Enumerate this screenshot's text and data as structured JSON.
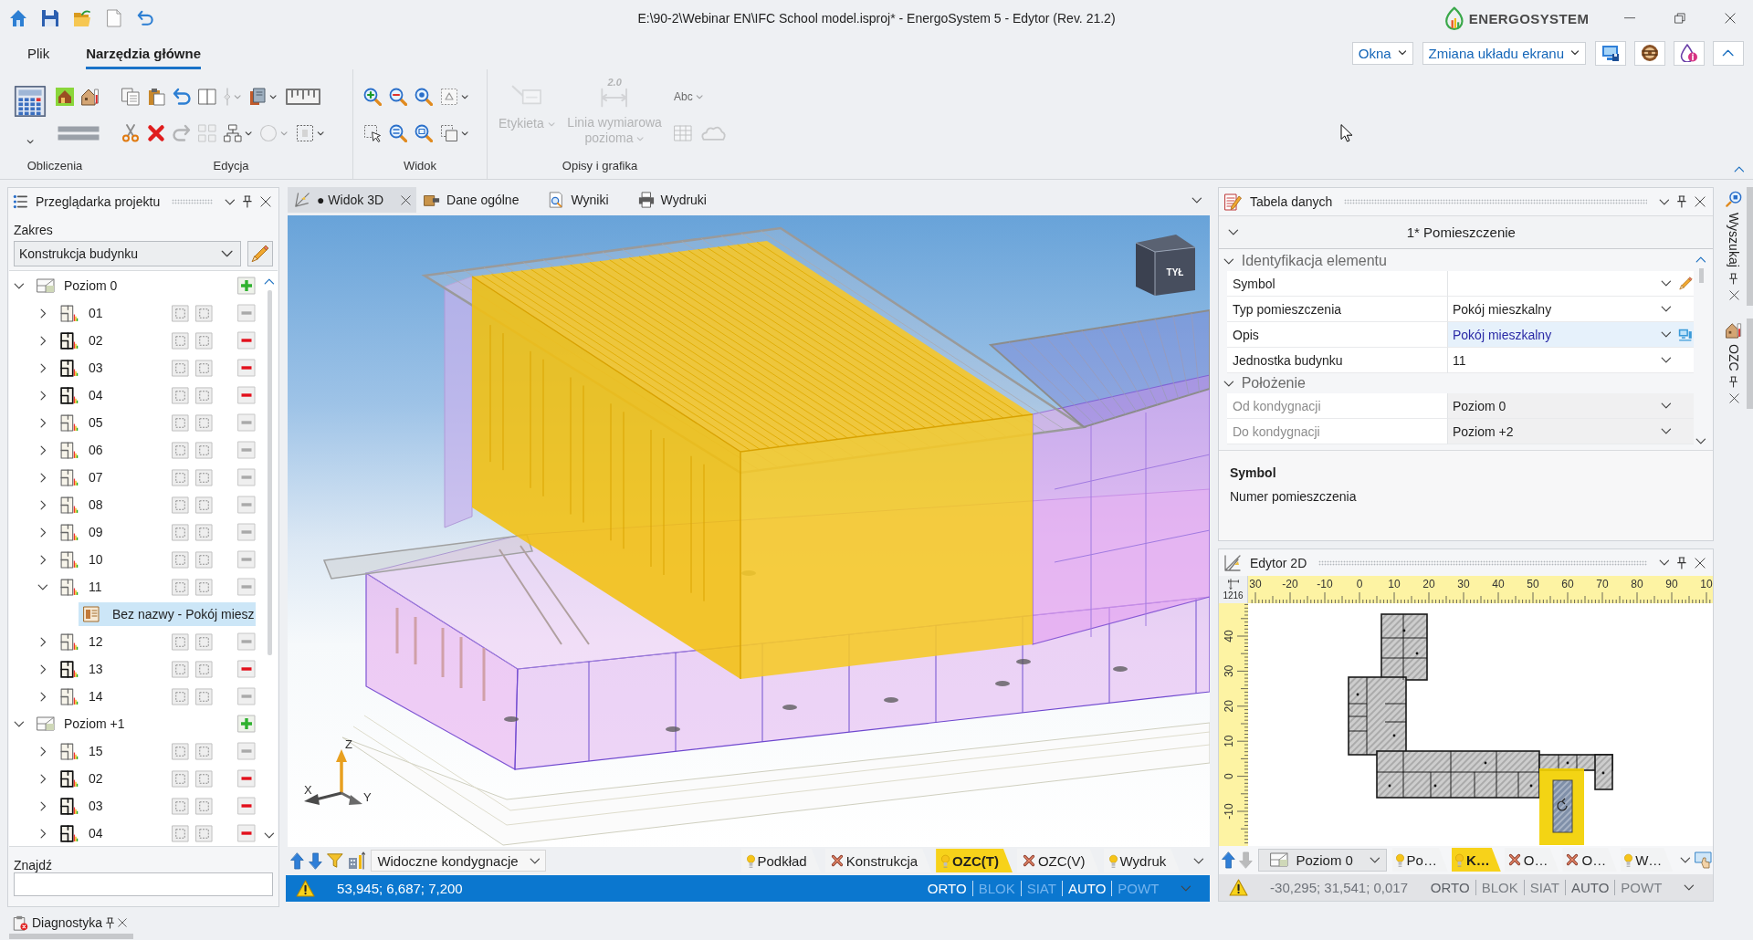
{
  "window": {
    "title": "E:\\90-2\\Webinar EN\\IFC School model.isproj* - EnergoSystem 5 - Edytor (Rev. 21.2)",
    "logo": "ENERGOSYSTEM"
  },
  "ribbon": {
    "tabs": [
      {
        "label": "Plik",
        "selected": false
      },
      {
        "label": "Narzędzia główne",
        "selected": true
      }
    ],
    "menus": [
      "Okna",
      "Zmiana układu ekranu"
    ],
    "groups": [
      {
        "label": "Obliczenia",
        "large": [
          {
            "kind": "calculator",
            "disabled": false,
            "dropdown": true
          }
        ],
        "rows": [
          [
            {
              "kind": "house",
              "disabled": false,
              "dropdown": false
            },
            {
              "kind": "house-thermometer",
              "disabled": false,
              "dropdown": false
            }
          ],
          [
            {
              "kind": "double-line",
              "disabled": false,
              "dropdown": false
            }
          ]
        ]
      },
      {
        "label": "Edycja",
        "rows": [
          [
            {
              "kind": "copy",
              "disabled": false,
              "dropdown": false
            },
            {
              "kind": "clipboard",
              "disabled": false,
              "dropdown": false
            },
            {
              "kind": "undo-arrow",
              "disabled": false,
              "dropdown": false
            },
            {
              "kind": "split-panel",
              "disabled": false,
              "dropdown": false
            },
            {
              "kind": "vertical-line",
              "disabled": true,
              "dropdown": true
            },
            {
              "kind": "book-stack",
              "disabled": false,
              "dropdown": true
            },
            {
              "kind": "ruler-strip",
              "disabled": false,
              "dropdown": false
            }
          ],
          [
            {
              "kind": "scissors",
              "disabled": false,
              "dropdown": false
            },
            {
              "kind": "cross",
              "disabled": false,
              "dropdown": false
            },
            {
              "kind": "redo-arrow",
              "disabled": true,
              "dropdown": false
            },
            {
              "kind": "tile-grid",
              "disabled": true,
              "dropdown": false
            },
            {
              "kind": "network",
              "disabled": false,
              "dropdown": true
            },
            {
              "kind": "circle",
              "disabled": true,
              "dropdown": true
            },
            {
              "kind": "dashed-frame",
              "disabled": false,
              "dropdown": true
            }
          ]
        ]
      },
      {
        "label": "Widok",
        "rows": [
          [
            {
              "kind": "magnifier-plus",
              "disabled": false,
              "dropdown": false
            },
            {
              "kind": "magnifier-minus",
              "disabled": false,
              "dropdown": false
            },
            {
              "kind": "magnifier",
              "disabled": false,
              "dropdown": false
            },
            {
              "kind": "dashed-square",
              "disabled": false,
              "dropdown": true
            }
          ],
          [
            {
              "kind": "dashed-pointer",
              "disabled": false,
              "dropdown": false
            },
            {
              "kind": "magnifier-fit",
              "disabled": false,
              "dropdown": false
            },
            {
              "kind": "magnifier-window",
              "disabled": false,
              "dropdown": false
            },
            {
              "kind": "dashed-copy",
              "disabled": false,
              "dropdown": true
            }
          ]
        ]
      },
      {
        "label": "Opisy i grafika",
        "large": [
          {
            "kind": "tag",
            "label": "Etykieta",
            "disabled": true,
            "dropdown": true
          },
          {
            "kind": "dimension-line",
            "icon_text": "2.0",
            "label": "Linia wymiarowa pozioma",
            "disabled": true,
            "dropdown": true
          }
        ],
        "rows": [
          [
            {
              "kind": "text-style",
              "text": "Abc",
              "disabled": true,
              "dropdown": true
            }
          ],
          [
            {
              "kind": "table-grid",
              "disabled": true,
              "dropdown": false
            },
            {
              "kind": "cloud",
              "disabled": true,
              "dropdown": false
            }
          ]
        ]
      }
    ]
  },
  "project_browser": {
    "title": "Przeglądarka projektu",
    "scope_label": "Zakres",
    "scope_value": "Konstrukcja budynku",
    "search_label": "Znajdź",
    "tree": [
      {
        "label": "Poziom 0",
        "kind": "level",
        "expanded": true,
        "selected": false,
        "children": [
          {
            "label": "01",
            "kind": "unit",
            "expanded": false,
            "selected": false,
            "remove_enabled": false
          },
          {
            "label": "02",
            "kind": "unit",
            "expanded": false,
            "selected": false,
            "remove_enabled": true
          },
          {
            "label": "03",
            "kind": "unit",
            "expanded": false,
            "selected": false,
            "remove_enabled": true
          },
          {
            "label": "04",
            "kind": "unit",
            "expanded": false,
            "selected": false,
            "remove_enabled": true
          },
          {
            "label": "05",
            "kind": "unit",
            "expanded": false,
            "selected": false,
            "remove_enabled": false
          },
          {
            "label": "06",
            "kind": "unit",
            "expanded": false,
            "selected": false,
            "remove_enabled": false
          },
          {
            "label": "07",
            "kind": "unit",
            "expanded": false,
            "selected": false,
            "remove_enabled": false
          },
          {
            "label": "08",
            "kind": "unit",
            "expanded": false,
            "selected": false,
            "remove_enabled": false
          },
          {
            "label": "09",
            "kind": "unit",
            "expanded": false,
            "selected": false,
            "remove_enabled": false
          },
          {
            "label": "10",
            "kind": "unit",
            "expanded": false,
            "selected": false,
            "remove_enabled": false
          },
          {
            "label": "11",
            "kind": "unit",
            "expanded": true,
            "selected": false,
            "remove_enabled": false,
            "children": [
              {
                "label": "Bez nazwy - Pokój miesz",
                "kind": "room",
                "selected": true
              }
            ]
          },
          {
            "label": "12",
            "kind": "unit",
            "expanded": false,
            "selected": false,
            "remove_enabled": false
          },
          {
            "label": "13",
            "kind": "unit",
            "expanded": false,
            "selected": false,
            "remove_enabled": true
          },
          {
            "label": "14",
            "kind": "unit",
            "expanded": false,
            "selected": false,
            "remove_enabled": false
          }
        ]
      },
      {
        "label": "Poziom +1",
        "kind": "level",
        "expanded": true,
        "selected": false,
        "children": [
          {
            "label": "15",
            "kind": "unit",
            "expanded": false,
            "selected": false,
            "remove_enabled": false
          },
          {
            "label": "02",
            "kind": "unit",
            "expanded": false,
            "selected": false,
            "remove_enabled": true
          },
          {
            "label": "03",
            "kind": "unit",
            "expanded": false,
            "selected": false,
            "remove_enabled": true
          },
          {
            "label": "04",
            "kind": "unit",
            "expanded": false,
            "selected": false,
            "remove_enabled": true
          }
        ]
      }
    ]
  },
  "bottom_tabs": [
    {
      "label": "Diagnostyka"
    }
  ],
  "view_tabs": [
    {
      "label": "● Widok 3D",
      "kind": "view-3d",
      "selected": true
    },
    {
      "label": "Dane ogólne",
      "kind": "general-data",
      "selected": false
    },
    {
      "label": "Wyniki",
      "kind": "results",
      "selected": false
    },
    {
      "label": "Wydruki",
      "kind": "printouts",
      "selected": false
    }
  ],
  "view_3d": {
    "cube_label": "TYŁ",
    "axis_labels": [
      "X",
      "Y",
      "Z"
    ],
    "nav": {
      "up_disabled": false,
      "down_disabled": false
    },
    "levels_menu": "Widoczne kondygnacje",
    "layers": [
      {
        "label": "Podkład",
        "visible": true,
        "selected": false
      },
      {
        "label": "Konstrukcja",
        "visible": false,
        "selected": false
      },
      {
        "label": "OZC(T)",
        "visible": true,
        "selected": true
      },
      {
        "label": "OZC(V)",
        "visible": false,
        "selected": false
      },
      {
        "label": "Wydruk",
        "visible": true,
        "selected": false
      }
    ],
    "status": {
      "focused": true,
      "coordinates": "53,945; 6,687; 7,200",
      "toggles": [
        {
          "label": "ORTO",
          "on": true
        },
        {
          "label": "BLOK",
          "on": false
        },
        {
          "label": "SIAT",
          "on": false
        },
        {
          "label": "AUTO",
          "on": true
        },
        {
          "label": "POWT",
          "on": false
        }
      ]
    }
  },
  "data_table": {
    "title": "Tabela danych",
    "object": "1* Pomieszczenie",
    "categories": [
      {
        "label": "Identyfikacja elementu",
        "expanded": true,
        "rows": [
          {
            "name": "Symbol",
            "kind": "manual",
            "read_only": false
          },
          {
            "name": "Typ pomieszczenia",
            "value": "Pokój mieszkalny",
            "kind": "list",
            "read_only": false
          },
          {
            "name": "Opis",
            "value": "Pokój mieszkalny",
            "kind": "linked",
            "read_only": false
          },
          {
            "name": "Jednostka budynku",
            "value": "11",
            "kind": "list",
            "read_only": false
          }
        ]
      },
      {
        "label": "Położenie",
        "expanded": true,
        "rows": [
          {
            "name": "Od kondygnacji",
            "value": "Poziom 0",
            "kind": "list",
            "read_only": true
          },
          {
            "name": "Do kondygnacji",
            "value": "Poziom +2",
            "kind": "list",
            "read_only": true
          }
        ]
      }
    ],
    "help_title": "Symbol",
    "help_text": "Numer pomieszczenia"
  },
  "side_tabs": [
    {
      "label": "Wyszukaj",
      "kind": "search"
    },
    {
      "label": "OZC",
      "kind": "ozc"
    }
  ],
  "editor_2d": {
    "title": "Edytor 2D",
    "scale": "1216",
    "x_labels": [
      "30",
      "-20",
      "-10",
      "0",
      "10",
      "20",
      "30",
      "40",
      "50",
      "60",
      "70",
      "80",
      "90",
      "10"
    ],
    "y_labels": [
      "40",
      "30",
      "20",
      "10",
      "0",
      "-10"
    ],
    "nav": {
      "up_disabled": false,
      "down_disabled": true
    },
    "level": "Poziom 0",
    "layers": [
      {
        "label": "Po…",
        "visible": true,
        "selected": false
      },
      {
        "label": "K…",
        "visible": true,
        "selected": true
      },
      {
        "label": "O…",
        "visible": false,
        "selected": false
      },
      {
        "label": "O…",
        "visible": false,
        "selected": false
      },
      {
        "label": "W…",
        "visible": true,
        "selected": false
      }
    ],
    "status": {
      "focused": false,
      "coordinates": "-30,295; 31,541; 0,017",
      "toggles": [
        {
          "label": "ORTO",
          "on": true
        },
        {
          "label": "BLOK",
          "on": false
        },
        {
          "label": "SIAT",
          "on": false
        },
        {
          "label": "AUTO",
          "on": true
        },
        {
          "label": "POWT",
          "on": false
        }
      ]
    }
  }
}
